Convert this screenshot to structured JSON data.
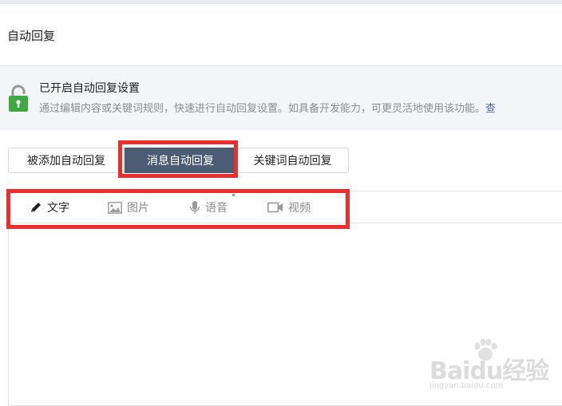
{
  "page": {
    "title": "自动回复"
  },
  "notice": {
    "title": "已开启自动回复设置",
    "description": "通过编辑内容或关键词规则，快速进行自动回复设置。如具备开发能力，可更灵活地使用该功能。",
    "link_fragment": "查"
  },
  "tabs": [
    {
      "label": "被添加自动回复",
      "active": false
    },
    {
      "label": "消息自动回复",
      "active": true
    },
    {
      "label": "关键词自动回复",
      "active": false
    }
  ],
  "toolbar": {
    "text_label": "文字",
    "image_label": "图片",
    "voice_label": "语音",
    "video_label": "视频"
  },
  "watermark": {
    "brand": "Baidu经验",
    "url": "jingyan.baidu.com"
  },
  "colors": {
    "active_tab": "#4d5c75",
    "highlight": "#ee2d2d",
    "lock": "#3daa3f",
    "notice_bg": "#f4f5f9"
  },
  "icons": [
    "lock-icon",
    "pencil-icon",
    "image-icon",
    "microphone-icon",
    "video-camera-icon"
  ]
}
